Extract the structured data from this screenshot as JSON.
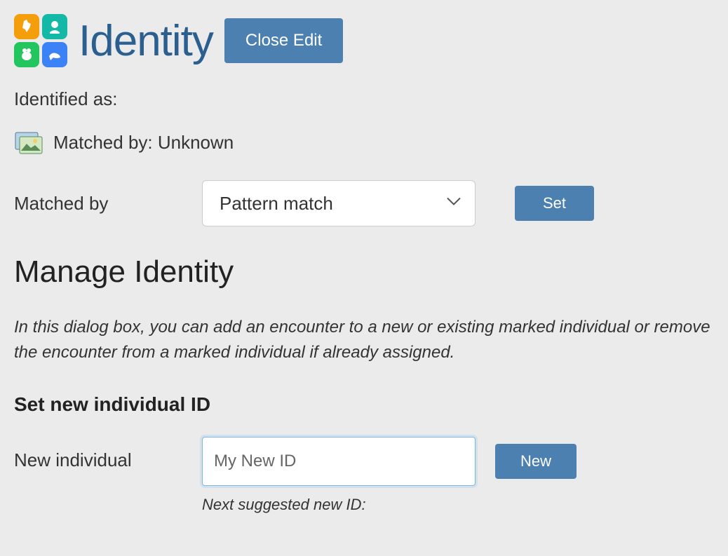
{
  "header": {
    "title": "Identity",
    "close_edit_label": "Close Edit"
  },
  "identified": {
    "label": "Identified as:"
  },
  "matched": {
    "prefix": "Matched by:",
    "value": "Unknown",
    "full": "Matched by: Unknown"
  },
  "match_form": {
    "label": "Matched by",
    "selected": "Pattern match",
    "set_label": "Set"
  },
  "manage": {
    "title": "Manage Identity",
    "help": "In this dialog box, you can add an encounter to a new or existing marked individual or remove the encounter from a marked individual if already assigned."
  },
  "set_new": {
    "heading": "Set new individual ID",
    "label": "New individual",
    "input_value": "My New ID",
    "new_button_label": "New",
    "hint": "Next suggested new ID:"
  }
}
